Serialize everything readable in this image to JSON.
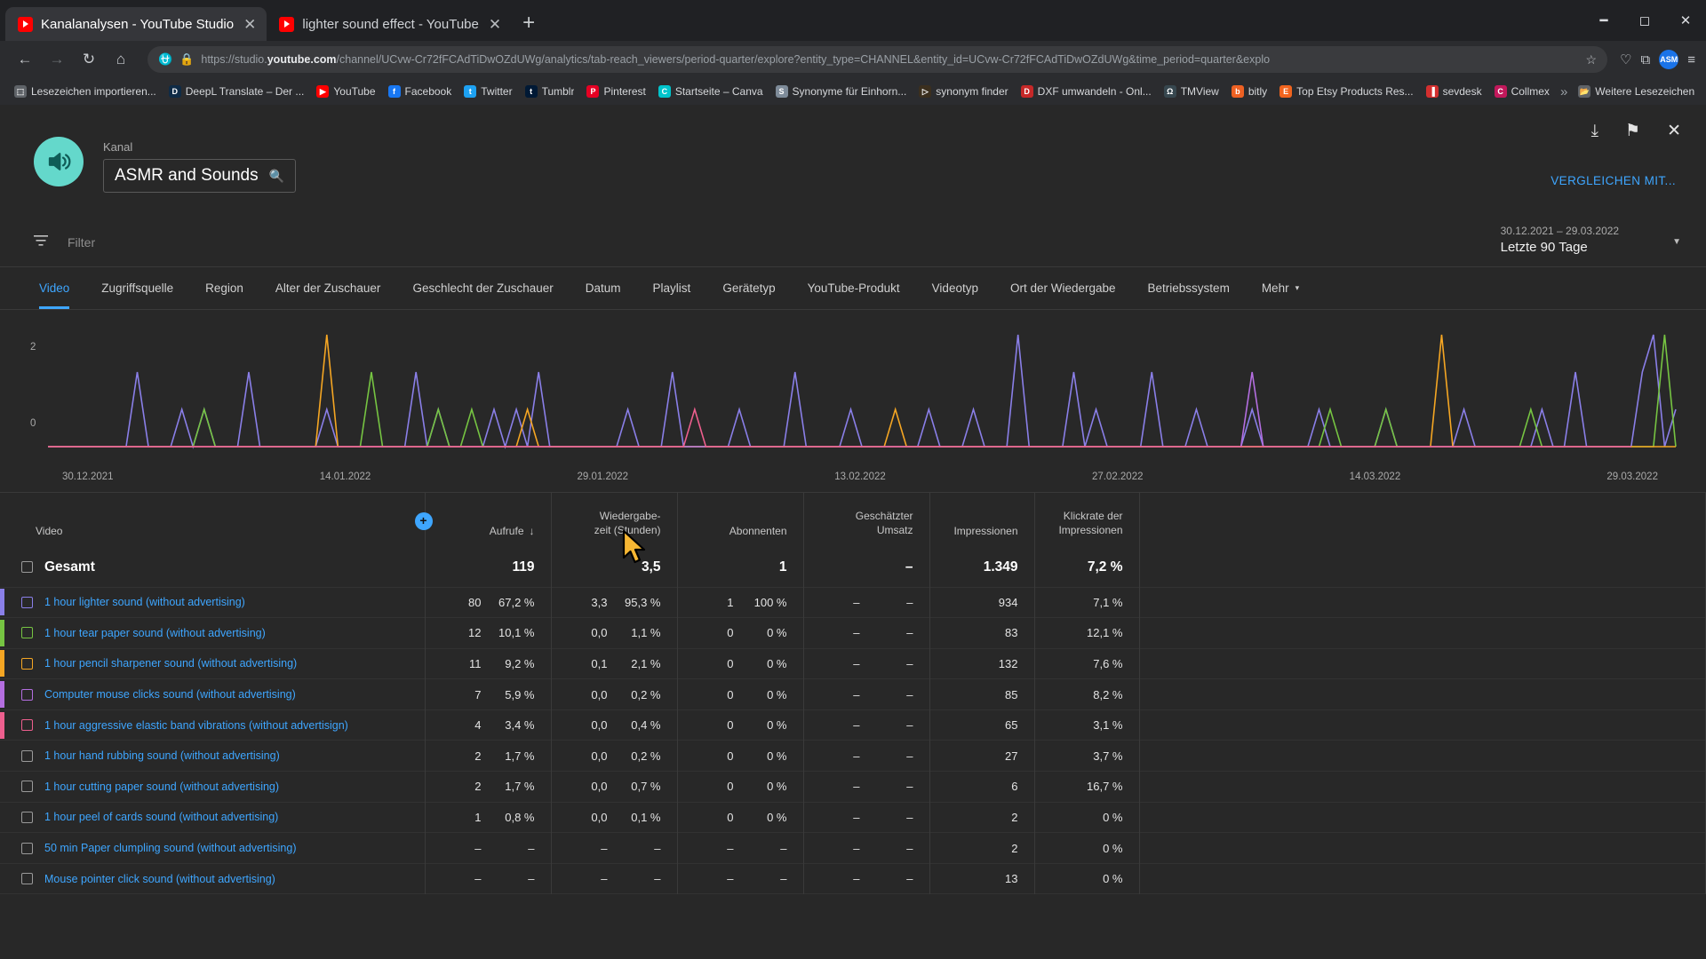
{
  "browser": {
    "tabs": [
      {
        "title": "Kanalanalysen - YouTube Studio",
        "active": true
      },
      {
        "title": "lighter sound effect - YouTube",
        "active": false
      }
    ],
    "new_tab_label": "+",
    "window_controls": {
      "minimize": "—",
      "maximize": "☐",
      "close": "✕"
    },
    "nav": {
      "back": "←",
      "forward": "→",
      "reload": "↻",
      "home": "⌂"
    },
    "omnibox": {
      "shield_icon": "⛉",
      "lock_icon": "🔒",
      "url_prefix": "https://studio.",
      "url_domain": "youtube.com",
      "url_suffix": "/channel/UCvw-Cr72fFCAdTiDwOZdUWg/analytics/tab-reach_viewers/period-quarter/explore?entity_type=CHANNEL&entity_id=UCvw-Cr72fFCAdTiDwOZdUWg&time_period=quarter&explo",
      "star_icon": "☆"
    },
    "toolbar_right": {
      "save_icon": "♡",
      "extension_icon": "⧉",
      "profile_initials": "ASM",
      "menu_icon": "≡"
    },
    "bookmarks": [
      {
        "label": "Lesezeichen importieren...",
        "color": "#5f6368",
        "glyph": "⬚"
      },
      {
        "label": "DeepL Translate – Der ...",
        "color": "#0f2b46",
        "glyph": "D"
      },
      {
        "label": "YouTube",
        "color": "#ff0000",
        "glyph": "▶"
      },
      {
        "label": "Facebook",
        "color": "#1877f2",
        "glyph": "f"
      },
      {
        "label": "Twitter",
        "color": "#1da1f2",
        "glyph": "t"
      },
      {
        "label": "Tumblr",
        "color": "#001935",
        "glyph": "t"
      },
      {
        "label": "Pinterest",
        "color": "#e60023",
        "glyph": "P"
      },
      {
        "label": "Startseite – Canva",
        "color": "#00c4cc",
        "glyph": "C"
      },
      {
        "label": "Synonyme für Einhorn...",
        "color": "#7e8b99",
        "glyph": "S"
      },
      {
        "label": "synonym finder",
        "color": "#3b2f1e",
        "glyph": "▷"
      },
      {
        "label": "DXF umwandeln - Onl...",
        "color": "#c62828",
        "glyph": "D"
      },
      {
        "label": "TMView",
        "color": "#37474f",
        "glyph": "Ω"
      },
      {
        "label": "bitly",
        "color": "#ee6123",
        "glyph": "b"
      },
      {
        "label": "Top Etsy Products Res...",
        "color": "#f1641e",
        "glyph": "E"
      },
      {
        "label": "sevdesk",
        "color": "#d32f2f",
        "glyph": "▐"
      },
      {
        "label": "Collmex",
        "color": "#c2185b",
        "glyph": "C"
      }
    ],
    "bookmarks_overflow": "»",
    "bookmarks_more": {
      "label": "Weitere Lesezeichen",
      "glyph": "🗀"
    }
  },
  "studio": {
    "top_icons": {
      "download": "⤓",
      "feedback": "⚑",
      "close": "✕"
    },
    "channel": {
      "label": "Kanal",
      "name": "ASMR and Sounds",
      "search_icon": "search-icon",
      "avatar_color": "#64d8cb"
    },
    "compare_button": "VERGLEICHEN MIT...",
    "filter": {
      "icon": "filter-icon",
      "placeholder": "Filter"
    },
    "date_range": {
      "range": "30.12.2021 – 29.03.2022",
      "preset": "Letzte 90 Tage",
      "caret": "▼"
    },
    "tabs": [
      {
        "label": "Video",
        "active": true
      },
      {
        "label": "Zugriffsquelle",
        "active": false
      },
      {
        "label": "Region",
        "active": false
      },
      {
        "label": "Alter der Zuschauer",
        "active": false
      },
      {
        "label": "Geschlecht der Zuschauer",
        "active": false
      },
      {
        "label": "Datum",
        "active": false
      },
      {
        "label": "Playlist",
        "active": false
      },
      {
        "label": "Gerätetyp",
        "active": false
      },
      {
        "label": "YouTube-Produkt",
        "active": false
      },
      {
        "label": "Videotyp",
        "active": false
      },
      {
        "label": "Ort der Wiedergabe",
        "active": false
      },
      {
        "label": "Betriebssystem",
        "active": false
      },
      {
        "label": "Mehr",
        "active": false,
        "caret": "▾"
      }
    ],
    "table": {
      "headers": {
        "video": "Video",
        "views": "Aufrufe",
        "views_sort": "↓",
        "watchtime_l1": "Wiedergabe-",
        "watchtime_l2": "zeit (Stunden)",
        "subscribers": "Abonnenten",
        "revenue_l1": "Geschätzter",
        "revenue_l2": "Umsatz",
        "impressions": "Impressionen",
        "ctr_l1": "Klickrate der",
        "ctr_l2": "Impressionen",
        "add_column": "+"
      },
      "total_row": {
        "name": "Gesamt",
        "views": "119",
        "watchtime": "3,5",
        "subscribers": "1",
        "revenue": "–",
        "impressions": "1.349",
        "ctr": "7,2 %"
      },
      "rows": [
        {
          "name": "1 hour lighter sound (without advertising)",
          "color": "#8a7fe8",
          "views": "80",
          "views_pct": "67,2 %",
          "watchtime": "3,3",
          "watchtime_pct": "95,3 %",
          "subscribers": "1",
          "subscribers_pct": "100 %",
          "revenue": "–",
          "revenue_pct": "–",
          "impressions": "934",
          "ctr": "7,1 %"
        },
        {
          "name": "1 hour tear paper sound (without advertising)",
          "color": "#76c442",
          "views": "12",
          "views_pct": "10,1 %",
          "watchtime": "0,0",
          "watchtime_pct": "1,1 %",
          "subscribers": "0",
          "subscribers_pct": "0 %",
          "revenue": "–",
          "revenue_pct": "–",
          "impressions": "83",
          "ctr": "12,1 %"
        },
        {
          "name": "1 hour pencil sharpener sound (without advertising)",
          "color": "#f5a623",
          "views": "11",
          "views_pct": "9,2 %",
          "watchtime": "0,1",
          "watchtime_pct": "2,1 %",
          "subscribers": "0",
          "subscribers_pct": "0 %",
          "revenue": "–",
          "revenue_pct": "–",
          "impressions": "132",
          "ctr": "7,6 %"
        },
        {
          "name": "Computer mouse clicks sound (without advertising)",
          "color": "#b46ee0",
          "views": "7",
          "views_pct": "5,9 %",
          "watchtime": "0,0",
          "watchtime_pct": "0,2 %",
          "subscribers": "0",
          "subscribers_pct": "0 %",
          "revenue": "–",
          "revenue_pct": "–",
          "impressions": "85",
          "ctr": "8,2 %"
        },
        {
          "name": "1 hour aggressive elastic band vibrations (without advertisign)",
          "color": "#ee5f8e",
          "views": "4",
          "views_pct": "3,4 %",
          "watchtime": "0,0",
          "watchtime_pct": "0,4 %",
          "subscribers": "0",
          "subscribers_pct": "0 %",
          "revenue": "–",
          "revenue_pct": "–",
          "impressions": "65",
          "ctr": "3,1 %"
        },
        {
          "name": "1 hour hand rubbing sound (without advertising)",
          "color": "",
          "views": "2",
          "views_pct": "1,7 %",
          "watchtime": "0,0",
          "watchtime_pct": "0,2 %",
          "subscribers": "0",
          "subscribers_pct": "0 %",
          "revenue": "–",
          "revenue_pct": "–",
          "impressions": "27",
          "ctr": "3,7 %"
        },
        {
          "name": "1 hour cutting paper sound (without advertising)",
          "color": "",
          "views": "2",
          "views_pct": "1,7 %",
          "watchtime": "0,0",
          "watchtime_pct": "0,7 %",
          "subscribers": "0",
          "subscribers_pct": "0 %",
          "revenue": "–",
          "revenue_pct": "–",
          "impressions": "6",
          "ctr": "16,7 %"
        },
        {
          "name": "1 hour peel of cards sound (without advertising)",
          "color": "",
          "views": "1",
          "views_pct": "0,8 %",
          "watchtime": "0,0",
          "watchtime_pct": "0,1 %",
          "subscribers": "0",
          "subscribers_pct": "0 %",
          "revenue": "–",
          "revenue_pct": "–",
          "impressions": "2",
          "ctr": "0 %"
        },
        {
          "name": "50 min Paper clumpling sound (without advertising)",
          "color": "",
          "views": "–",
          "views_pct": "–",
          "watchtime": "–",
          "watchtime_pct": "–",
          "subscribers": "–",
          "subscribers_pct": "–",
          "revenue": "–",
          "revenue_pct": "–",
          "impressions": "2",
          "ctr": "0 %"
        },
        {
          "name": "Mouse pointer click sound (without advertising)",
          "color": "",
          "views": "–",
          "views_pct": "–",
          "watchtime": "–",
          "watchtime_pct": "–",
          "subscribers": "–",
          "subscribers_pct": "–",
          "revenue": "–",
          "revenue_pct": "–",
          "impressions": "13",
          "ctr": "0 %"
        }
      ]
    }
  },
  "chart_data": {
    "type": "line",
    "title": "",
    "xlabel": "",
    "ylabel": "",
    "ylim": [
      0,
      3
    ],
    "yticks": [
      "0",
      "2"
    ],
    "grid": false,
    "x_tick_labels": [
      "30.12.2021",
      "14.01.2022",
      "29.01.2022",
      "13.02.2022",
      "27.02.2022",
      "14.03.2022",
      "29.03.2022"
    ],
    "legend_position": "none",
    "series": [
      {
        "name": "1 hour lighter sound (without advertising)",
        "color": "#8a7fe8",
        "values": [
          0,
          0,
          0,
          0,
          0,
          0,
          0,
          0,
          2,
          0,
          0,
          0,
          1,
          0,
          1,
          0,
          0,
          0,
          2,
          0,
          0,
          0,
          0,
          0,
          0,
          1,
          0,
          0,
          0,
          0,
          0,
          0,
          0,
          2,
          0,
          1,
          0,
          0,
          0,
          0,
          1,
          0,
          1,
          0,
          2,
          0,
          0,
          0,
          0,
          0,
          0,
          0,
          1,
          0,
          0,
          0,
          2,
          0,
          0,
          0,
          0,
          0,
          1,
          0,
          0,
          0,
          0,
          2,
          0,
          0,
          0,
          0,
          1,
          0,
          0,
          0,
          0,
          0,
          0,
          1,
          0,
          0,
          0,
          1,
          0,
          0,
          0,
          3,
          0,
          0,
          0,
          0,
          2,
          0,
          1,
          0,
          0,
          0,
          0,
          2,
          0,
          0,
          0,
          1,
          0,
          0,
          0,
          0,
          1,
          0,
          0,
          0,
          0,
          0,
          1,
          0,
          0,
          0,
          0,
          0,
          1,
          0,
          0,
          0,
          0,
          0,
          0,
          1,
          0,
          0,
          0,
          0,
          0,
          0,
          1,
          0,
          0,
          2,
          0,
          0,
          0,
          0,
          0,
          2,
          3,
          0,
          1
        ]
      },
      {
        "name": "1 hour tear paper sound (without advertising)",
        "color": "#76c442",
        "values": [
          0,
          0,
          0,
          0,
          0,
          0,
          0,
          0,
          0,
          0,
          0,
          0,
          0,
          0,
          1,
          0,
          0,
          0,
          0,
          0,
          0,
          0,
          0,
          0,
          0,
          0,
          0,
          0,
          0,
          2,
          0,
          0,
          0,
          0,
          0,
          1,
          0,
          0,
          1,
          0,
          0,
          0,
          0,
          0,
          0,
          0,
          0,
          0,
          0,
          0,
          0,
          0,
          0,
          0,
          0,
          0,
          0,
          0,
          0,
          0,
          0,
          0,
          0,
          0,
          0,
          0,
          0,
          0,
          0,
          0,
          0,
          0,
          0,
          0,
          0,
          0,
          0,
          0,
          0,
          0,
          0,
          0,
          0,
          0,
          0,
          0,
          0,
          0,
          0,
          0,
          0,
          0,
          0,
          0,
          0,
          0,
          0,
          0,
          0,
          0,
          0,
          0,
          0,
          0,
          0,
          0,
          0,
          0,
          0,
          0,
          0,
          0,
          0,
          0,
          0,
          1,
          0,
          0,
          0,
          0,
          1,
          0,
          0,
          0,
          0,
          0,
          0,
          0,
          0,
          0,
          0,
          0,
          0,
          1,
          0,
          0,
          0,
          0,
          0,
          0,
          0,
          0,
          0,
          0,
          0,
          3,
          0
        ]
      },
      {
        "name": "1 hour pencil sharpener sound (without advertising)",
        "color": "#f5a623",
        "values": [
          0,
          0,
          0,
          0,
          0,
          0,
          0,
          0,
          0,
          0,
          0,
          0,
          0,
          0,
          0,
          0,
          0,
          0,
          0,
          0,
          0,
          0,
          0,
          0,
          0,
          3,
          0,
          0,
          0,
          0,
          0,
          0,
          0,
          0,
          0,
          0,
          0,
          0,
          0,
          0,
          0,
          0,
          0,
          1,
          0,
          0,
          0,
          0,
          0,
          0,
          0,
          0,
          0,
          0,
          0,
          0,
          0,
          0,
          0,
          0,
          0,
          0,
          0,
          0,
          0,
          0,
          0,
          0,
          0,
          0,
          0,
          0,
          0,
          0,
          0,
          0,
          1,
          0,
          0,
          0,
          0,
          0,
          0,
          0,
          0,
          0,
          0,
          0,
          0,
          0,
          0,
          0,
          0,
          0,
          0,
          0,
          0,
          0,
          0,
          0,
          0,
          0,
          0,
          0,
          0,
          0,
          0,
          0,
          0,
          0,
          0,
          0,
          0,
          0,
          0,
          0,
          0,
          0,
          0,
          0,
          0,
          0,
          0,
          0,
          0,
          3,
          0,
          0,
          0,
          0,
          0,
          0,
          0,
          0,
          0,
          0,
          0,
          0,
          0,
          0,
          0,
          0,
          0,
          0,
          0,
          0,
          0
        ]
      },
      {
        "name": "Computer mouse clicks sound (without advertising)",
        "color": "#b46ee0",
        "values": [
          0,
          0,
          0,
          0,
          0,
          0,
          0,
          0,
          0,
          0,
          0,
          0,
          0,
          0,
          0,
          0,
          0,
          0,
          0,
          0,
          0,
          0,
          0,
          0,
          0,
          0,
          0,
          0,
          0,
          0,
          0,
          0,
          0,
          0,
          0,
          0,
          0,
          0,
          0,
          0,
          0,
          0,
          0,
          0,
          0,
          0,
          0,
          0,
          0,
          0,
          0,
          0,
          0,
          0,
          0,
          0,
          0,
          0,
          0,
          0,
          0,
          0,
          0,
          0,
          0,
          0,
          0,
          0,
          0,
          0,
          0,
          0,
          0,
          0,
          0,
          0,
          0,
          0,
          0,
          0,
          0,
          0,
          0,
          0,
          0,
          0,
          0,
          0,
          0,
          0,
          0,
          0,
          0,
          0,
          0,
          0,
          0,
          0,
          0,
          0,
          0,
          0,
          0,
          0,
          0,
          0,
          0,
          0,
          2,
          0,
          0,
          0,
          0,
          0,
          0,
          0,
          0,
          0,
          0,
          0,
          0,
          0,
          0,
          0,
          0,
          0,
          0,
          0,
          0,
          0,
          0,
          0,
          0,
          0,
          0,
          0,
          0,
          0,
          0,
          0,
          0,
          0,
          0
        ]
      },
      {
        "name": "1 hour aggressive elastic band vibrations (without advertisign)",
        "color": "#ee5f8e",
        "values": [
          0,
          0,
          0,
          0,
          0,
          0,
          0,
          0,
          0,
          0,
          0,
          0,
          0,
          0,
          0,
          0,
          0,
          0,
          0,
          0,
          0,
          0,
          0,
          0,
          0,
          0,
          0,
          0,
          0,
          0,
          0,
          0,
          0,
          0,
          0,
          0,
          0,
          0,
          0,
          0,
          0,
          0,
          0,
          0,
          0,
          0,
          0,
          0,
          0,
          0,
          0,
          0,
          0,
          0,
          0,
          0,
          0,
          0,
          1,
          0,
          0,
          0,
          0,
          0,
          0,
          0,
          0,
          0,
          0,
          0,
          0,
          0,
          0,
          0,
          0,
          0,
          0,
          0,
          0,
          0,
          0,
          0,
          0,
          0,
          0,
          0,
          0,
          0,
          0,
          0,
          0,
          0,
          0,
          0,
          0,
          0,
          0,
          0,
          0,
          0,
          0,
          0,
          0,
          0,
          0,
          0,
          0,
          0,
          0,
          0,
          0,
          0,
          0,
          0,
          0,
          0,
          0,
          0,
          0,
          0,
          0,
          0,
          0,
          0,
          0,
          0,
          0,
          0,
          0,
          0,
          0,
          0,
          0,
          0,
          0,
          0,
          0,
          0,
          0,
          0,
          0,
          0,
          0
        ]
      }
    ]
  }
}
